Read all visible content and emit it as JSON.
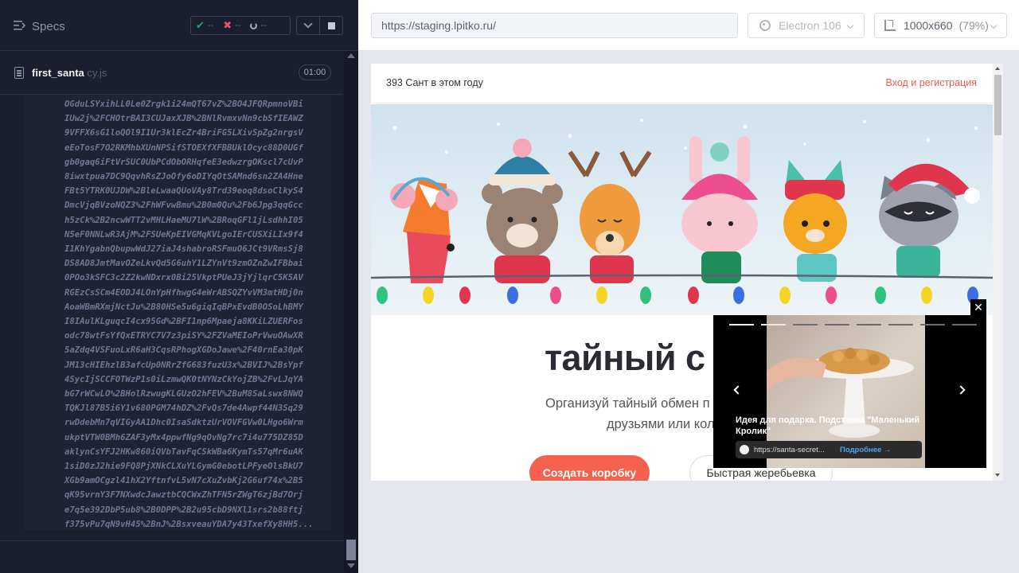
{
  "reporter": {
    "specs_title": "Specs",
    "stats": {
      "passed": "--",
      "failed": "--",
      "pending": "--"
    },
    "spec_file": {
      "name": "first_santa",
      "ext": " cy.js",
      "duration": "01:00"
    },
    "log_lines": [
      "OGduLSYxihLL0Le0Zrgk1i24mQT67vZ%2BO4JFQRpmnoVBi",
      "IUw2j%2FCHOtrBAI3CUJaxXJB%2BNlRvmxvNn9cbSfIEAWZ",
      "9VFFX6sG1loQOl9I1Ur3klEcZr4BriFG5LXivSpZg2nrgsV",
      "eEoTosF7O2RKMhbXUnNPSifSTOEXfXFBBUklOcyc88D0UGf",
      "gb0gaq6iFtVrSUC0UbPCdObORHqfeE3edwzrgOKscl7cUvP",
      "8iwxtpua7DC9QqvhRsZJoOfy6oDIYqOtSAMnd6sn2ZA4Hne",
      "FBt5YTRK0UJDW%2BleLwaaQUoVAy8Trd39eoq8dsoClkyS4",
      "DmcVjqBVzoNQZ3%2FhWFvwBmu%2B0m0Qu%2Fb6Jpg3qqGcc",
      "h5zCk%2B2ncwWTT2vMHLHaeMU7lW%2BRoqGFl1jLsdhhI05",
      "N5eF0NNLwR3AjM%2FSUeKpEIVGMqKVLgoIErCUSXiLIx9f4",
      "I1KhYgabnQbupwWdJ27iaJ4shabroRSFmuO6JCt9VRmsSj8",
      "DS8AD8JmtMavOZeLkvQd5G6uhY1LZYnVt9zmOZnZwIFBbai",
      "0POo3kSFC3c2Z2kwNDxrx0Bi25VkptPUeJ3jYjlqrC5K5AV",
      "RGEzCsSCm4EODJ4LOnYpHfhwgG4eWrABSQZYvVM3mtHDj0n",
      "AoaWBmRXmjNctJu%2B80HSe5u6giqIqBPxEvdB0OSoLhBMY",
      "I8IAulKLguqcI4cx95Gd%2BFI1np6Mpaeja8KKiLZUERFos",
      "odc78wtFsYfQxETRYC7V7z3piSY%2FZVaMEIoPrVwuOAwXR",
      "5aZdq4VSFuoLxR6aH3CqsRPhogXGDoJawe%2F40rnEa30pK",
      "JM13cHIEhzlB3afcUp0NRrZfG683fuzU3x%2BVIJ%2BsYpf",
      "4SycIjSCCFOTWzP1s0iLzmwQK0tNYNzCkYojZB%2FvLJqYA",
      "bG7rWCwLO%2BHolRzwugKLGUzO2hFEV%2BuM8SaLswx8NWQ",
      "TQKJl87B5i6Y1v680PGM74hDZ%2FvQs7de4Awpf44N3Sq29",
      "rwDdebMn7qVIGyAA1Dhc0IsaSdktzUrVOVFGVw0LHgo6Wrm",
      "ukptVTW0BMh6ZAF3yMx4ppwfNg9qOvNg7rc7i4u775DZ85D",
      "aklynCsYFJ2HKw860iQVbTavFqCSkWBa6KymTs57qMr6uAK",
      "1siD0zJ2hie9FQ8PjXNkCLXuYLGymG0ebotLPFyeOlsBkU7",
      "XGb9amOCgzl41hX2YftnfvL5vN7cXuZvbKj2G6uf74x%2B5",
      "qK95vrnY3F7NXwdcJawztbCQCWxZhTFN5rZWgT6zjBd7Orj",
      "e7q5e392DbP5ub8%2B0DPP%2B2u95cbD9NXl1srs2b88ftj",
      "f375vPu7qN9vH45%2BnJ%2BsxveauYDA7y43TxefXy8HH5..."
    ]
  },
  "toolbar": {
    "url": "https://staging.lpitko.ru/",
    "browser": "Electron 106",
    "viewport": "1000x660",
    "viewport_scale": "(79%)"
  },
  "site": {
    "santa_count": "393 Сант в этом году",
    "login": "Вход и регистрация",
    "title": "тайный с",
    "subtitle_line1": "Организуй тайный обмен п",
    "subtitle_line2": "друзьями или кол",
    "create_button": "Создать коробку",
    "quick_button": "Быстрая жеребьевка"
  },
  "ad": {
    "close": "✕",
    "title": "Идея для подарка. Подставка \"Маленький Кролик\"",
    "url": "https://santa-secret...",
    "more": "Подробнее →"
  },
  "colors": {
    "reporter_bg": "#1b1e2e",
    "accent_red": "#f4624f",
    "pass_green": "#1fa971",
    "fail_red": "#e45770"
  }
}
